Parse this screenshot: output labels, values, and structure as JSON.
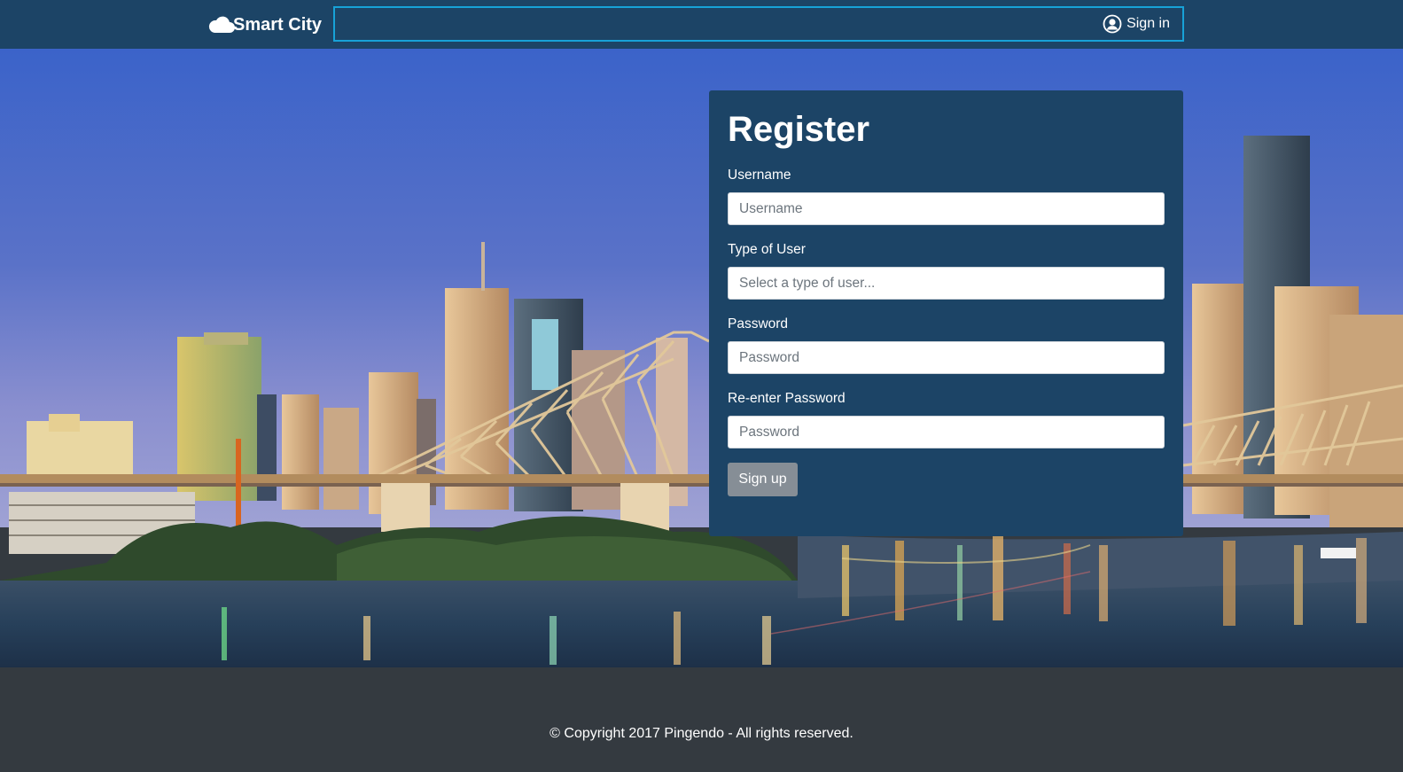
{
  "navbar": {
    "brand": "Smart City",
    "brand_icon": "cloud-icon",
    "signin_label": "Sign in",
    "signin_icon": "user-circle-icon",
    "background": "#1c4466",
    "accent": "#17a2d8"
  },
  "form": {
    "title": "Register",
    "fields": [
      {
        "label": "Username",
        "placeholder": "Username"
      },
      {
        "label": "Type of User",
        "placeholder": "Select a type of user..."
      },
      {
        "label": "Password",
        "placeholder": "Password"
      },
      {
        "label": "Re-enter Password",
        "placeholder": "Password"
      }
    ],
    "submit_label": "Sign up",
    "background": "#1c4466",
    "button_color": "#868e96"
  },
  "footer": {
    "text": "© Copyright 2017 Pingendo - All rights reserved.",
    "background": "#343a40"
  }
}
